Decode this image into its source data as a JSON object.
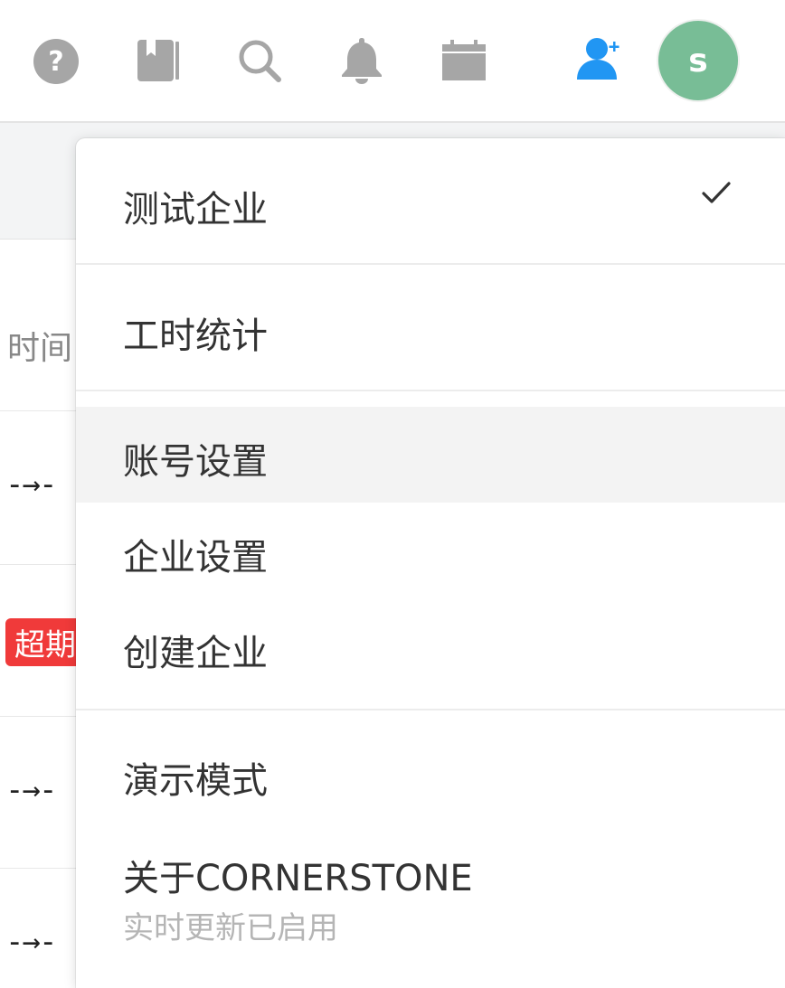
{
  "header": {
    "icons": [
      "help-icon",
      "book-icon",
      "search-icon",
      "bell-icon",
      "calendar-icon",
      "add-member-icon"
    ],
    "avatar_initial": "s",
    "avatar_color": "#78bd96",
    "icon_color": "#a6a6a6",
    "add_member_color": "#2196f3"
  },
  "background": {
    "column_header": "时间",
    "rows": [
      {
        "range": "-→-"
      },
      {
        "badge": "超期"
      },
      {
        "range": "-→-"
      },
      {
        "range": "-→-"
      }
    ],
    "badge_color": "#f03a3a"
  },
  "menu": {
    "current_org": {
      "label": "测试企业",
      "checked": true
    },
    "timesheet": {
      "label": "工时统计"
    },
    "account_settings": {
      "label": "账号设置"
    },
    "org_settings": {
      "label": "企业设置"
    },
    "create_org": {
      "label": "创建企业"
    },
    "demo_mode": {
      "label": "演示模式"
    },
    "about": {
      "label": "关于CORNERSTONE",
      "sublabel": "实时更新已启用"
    }
  }
}
